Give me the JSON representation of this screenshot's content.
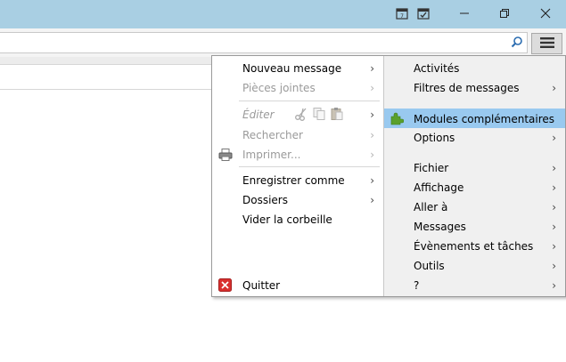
{
  "titlebar": {
    "icons": [
      "calendar-icon",
      "tasks-icon"
    ],
    "controls": [
      "minimize-icon",
      "restore-icon",
      "close-icon"
    ]
  },
  "search": {
    "value": "",
    "placeholder": ""
  },
  "menu_button": {
    "icon": "hamburger-menu-icon"
  },
  "left_menu": {
    "nouveau_message": "Nouveau message",
    "pieces_jointes": "Pièces jointes",
    "editer": "Éditer",
    "rechercher": "Rechercher",
    "imprimer": "Imprimer...",
    "enregistrer_comme": "Enregistrer comme",
    "dossiers": "Dossiers",
    "vider_corbeille": "Vider la corbeille",
    "quitter": "Quitter"
  },
  "right_menu": {
    "activites": "Activités",
    "filtres": "Filtres de messages",
    "modules": "Modules complémentaires",
    "options": "Options",
    "fichier": "Fichier",
    "affichage": "Affichage",
    "aller_a": "Aller à",
    "messages": "Messages",
    "evenements": "Évènements et tâches",
    "outils": "Outils",
    "aide": "?"
  },
  "arrow": "›",
  "colors": {
    "titlebar": "#a9cfe3",
    "highlight": "#99c9ef",
    "right_pane": "#f0f0f0"
  }
}
